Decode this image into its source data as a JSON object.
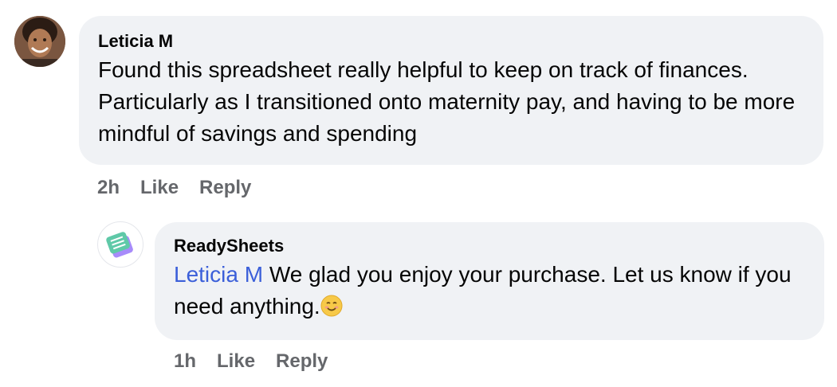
{
  "comment": {
    "author": "Leticia M",
    "text": "Found this spreadsheet really helpful to keep on track of finances. Particularly as I transitioned onto maternity pay, and having to be more mindful of savings and spending",
    "time": "2h",
    "like_label": "Like",
    "reply_label": "Reply"
  },
  "reply": {
    "author": "ReadySheets",
    "mention": "Leticia M",
    "text": "We glad you enjoy your purchase. Let us know if you need anything.",
    "emoji": "smiling-face-emoji",
    "time": "1h",
    "like_label": "Like",
    "reply_label": "Reply"
  },
  "colors": {
    "bubble": "#f0f2f5",
    "mention": "#3b5fd9",
    "muted": "#65676b",
    "logo_green": "#5fc9a8",
    "logo_purple": "#a78bfa"
  }
}
